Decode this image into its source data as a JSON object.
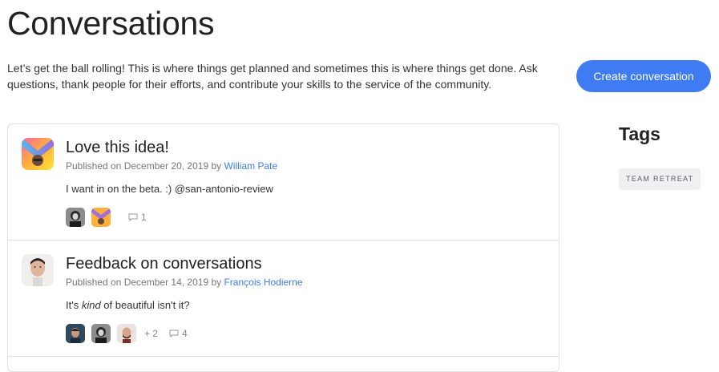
{
  "page": {
    "title": "Conversations",
    "intro": "Let’s get the ball rolling! This is where things get planned and sometimes this is where things get done. Ask questions, thank people for their efforts, and contribute your skills to the service of the community.",
    "create_button": "Create conversation"
  },
  "conversations": [
    {
      "title": "Love this idea!",
      "published_prefix": "Published on December 20, 2019 by ",
      "author": "William Pate",
      "body": "I want in on the beta. :) @san-antonio-review",
      "participants": [
        "avatar-woman-bw",
        "avatar-gradient-logo"
      ],
      "extra_participants": "",
      "comment_count": "1",
      "avatar": "avatar-gradient-logo"
    },
    {
      "title": "Feedback on conversations",
      "published_prefix": "Published on December 14, 2019 by ",
      "author": "François Hodierne",
      "body_pre": "It's ",
      "body_em": "kind",
      "body_post": " of beautiful isn't it?",
      "participants": [
        "avatar-man-dark",
        "avatar-woman-bw",
        "avatar-man-beard"
      ],
      "extra_participants": "+ 2",
      "comment_count": "4",
      "avatar": "avatar-man-photo"
    }
  ],
  "sidebar": {
    "tags_heading": "Tags",
    "tags": [
      "TEAM RETREAT"
    ]
  },
  "colors": {
    "accent": "#3f7cf4",
    "border": "#e1e1e1",
    "tag_bg": "#eef0f2"
  }
}
